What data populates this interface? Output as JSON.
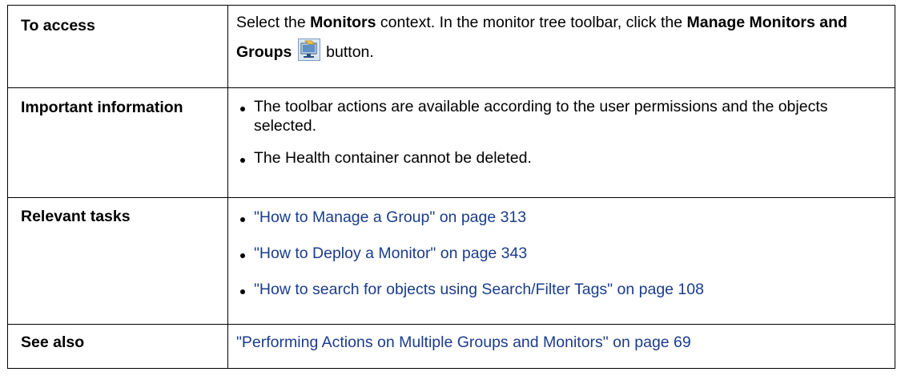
{
  "rows": {
    "access": {
      "label": "To access",
      "t1": "Select the ",
      "b1": "Monitors",
      "t2": " context. In the monitor tree toolbar, click the ",
      "b2": "Manage Monitors and Groups",
      "t3": " button.",
      "icon": "manage-monitors-and-groups-icon"
    },
    "important": {
      "label": "Important information",
      "items": [
        "The toolbar actions are available according to the user permissions and the objects selected.",
        "The Health container cannot be deleted."
      ]
    },
    "tasks": {
      "label": "Relevant tasks",
      "links": [
        "\"How to Manage a Group\" on page 313",
        "\"How to Deploy a Monitor\" on page 343",
        "\"How to search for objects using Search/Filter Tags\" on page 108"
      ]
    },
    "see_also": {
      "label": "See also",
      "link": "\"Performing Actions on Multiple Groups and Monitors\" on page 69"
    }
  },
  "colors": {
    "link": "#1a3c8c",
    "border": "#000000",
    "text": "#000000"
  }
}
